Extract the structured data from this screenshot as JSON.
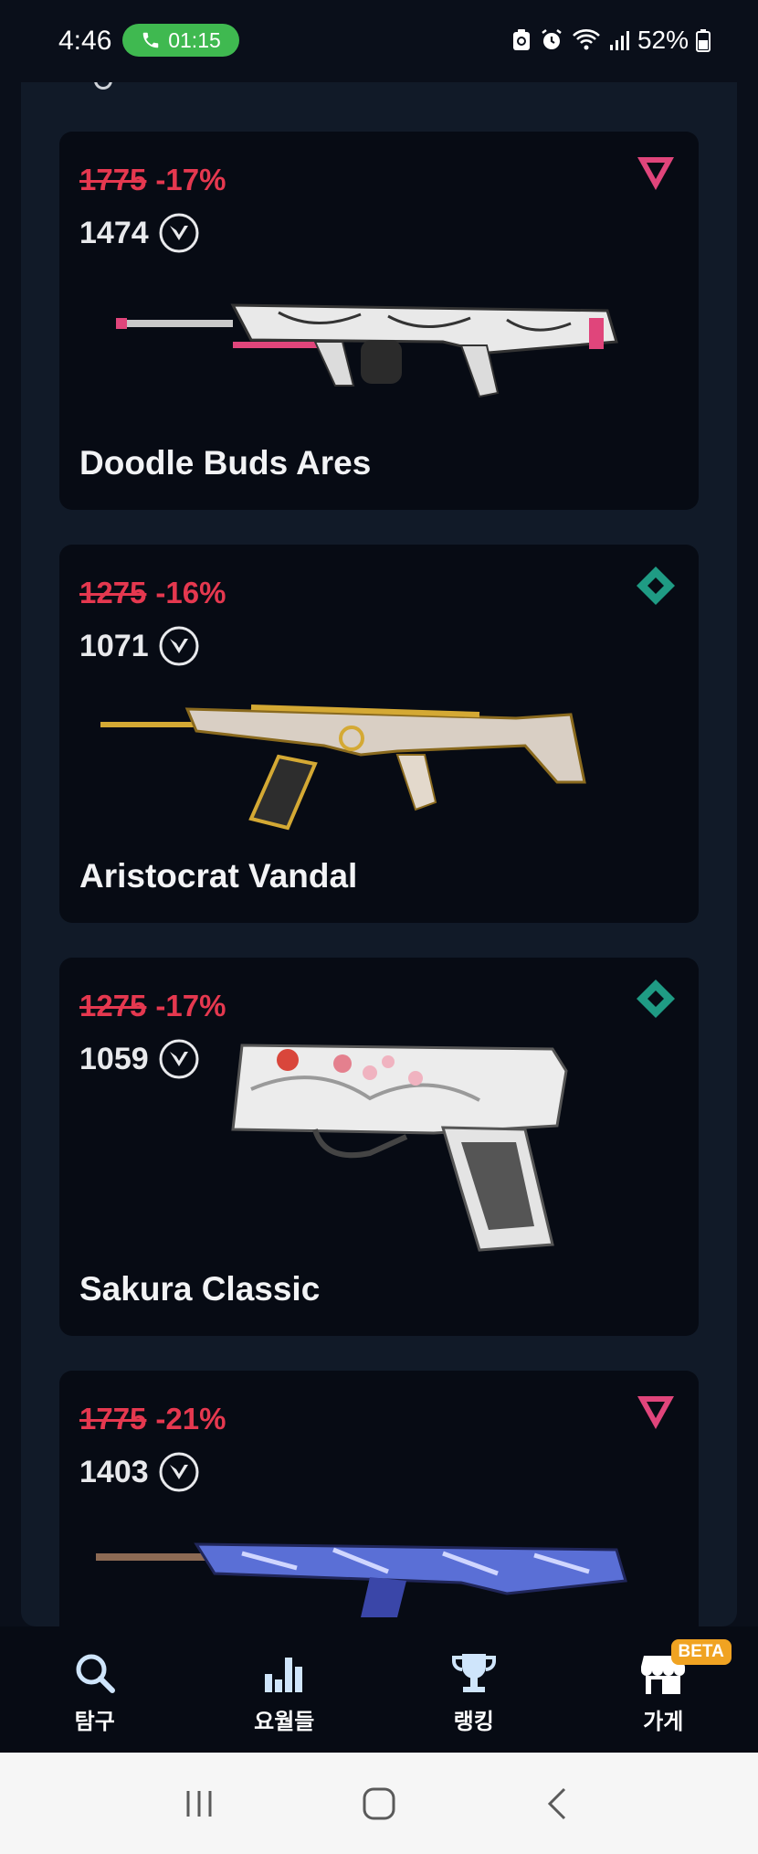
{
  "status_bar": {
    "time": "4:46",
    "call_timer": "01:15",
    "battery": "52%"
  },
  "cards": [
    {
      "old_price": "1775",
      "discount": "-17%",
      "price": "1474",
      "name": "Doodle Buds Ares",
      "tier": "triangle",
      "tier_color": "#e0457b"
    },
    {
      "old_price": "1275",
      "discount": "-16%",
      "price": "1071",
      "name": "Aristocrat Vandal",
      "tier": "diamond",
      "tier_color": "#1f9b84"
    },
    {
      "old_price": "1275",
      "discount": "-17%",
      "price": "1059",
      "name": "Sakura Classic",
      "tier": "diamond",
      "tier_color": "#1f9b84"
    },
    {
      "old_price": "1775",
      "discount": "-21%",
      "price": "1403",
      "name": "",
      "tier": "triangle",
      "tier_color": "#e0457b"
    }
  ],
  "nav": {
    "explore": "탐구",
    "stats": "요월들",
    "ranking": "랭킹",
    "store": "가게",
    "beta": "BETA"
  },
  "colors": {
    "accent_red": "#e5384f",
    "call_green": "#3fb950",
    "beta_orange": "#f0a322"
  }
}
